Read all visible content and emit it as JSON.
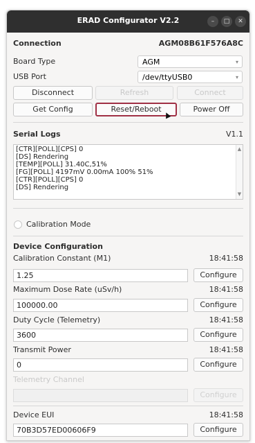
{
  "window": {
    "title": "ERAD Configurator V2.2"
  },
  "connection": {
    "heading": "Connection",
    "device_id": "AGM08B61F576A8C",
    "board_type_label": "Board Type",
    "board_type_value": "AGM",
    "usb_port_label": "USB Port",
    "usb_port_value": "/dev/ttyUSB0",
    "disconnect": "Disconnect",
    "refresh": "Refresh",
    "connect": "Connect",
    "get_config": "Get Config",
    "reset_reboot": "Reset/Reboot",
    "power_off": "Power Off"
  },
  "serial_logs": {
    "heading": "Serial Logs",
    "version": "V1.1",
    "lines": [
      "[CTR][POLL][CPS] 0",
      "[DS] Rendering",
      "[TEMP][POLL] 31.40C,51%",
      "[FG][POLL] 4197mV 0.00mA 100% 51%",
      "[CTR][POLL][CPS] 0",
      "[DS] Rendering"
    ]
  },
  "calibration_mode": {
    "label": "Calibration Mode"
  },
  "device_config": {
    "heading": "Device Configuration",
    "configure_label": "Configure",
    "fields": [
      {
        "label": "Calibration Constant (M1)",
        "time": "18:41:58",
        "value": "1.25"
      },
      {
        "label": "Maximum Dose Rate (uSv/h)",
        "time": "18:41:58",
        "value": "100000.00"
      },
      {
        "label": "Duty Cycle (Telemetry)",
        "time": "18:41:58",
        "value": "3600"
      },
      {
        "label": "Transmit Power",
        "time": "18:41:58",
        "value": "0"
      },
      {
        "label": "Telemetry Channel",
        "time": "",
        "value": ""
      },
      {
        "label": "Device EUI",
        "time": "18:41:58",
        "value": "70B3D57ED00606F9"
      }
    ]
  },
  "colors": {
    "highlight": "#a03045",
    "titlebar": "#2f2f2f"
  }
}
